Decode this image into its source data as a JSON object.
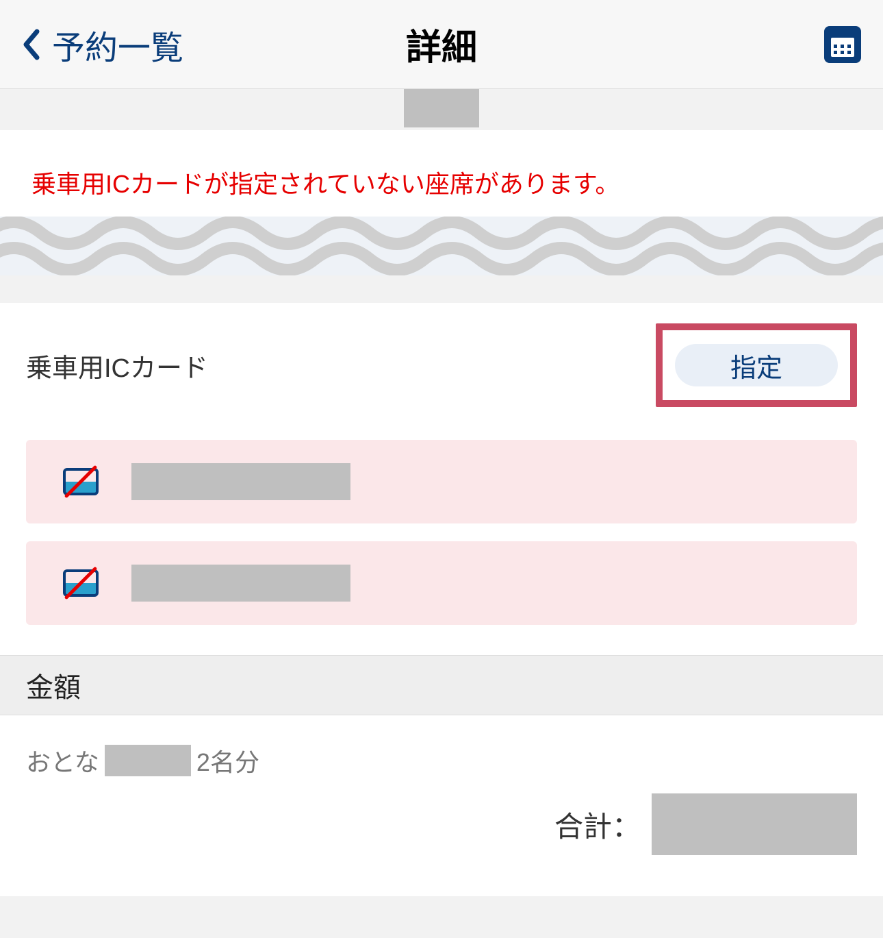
{
  "header": {
    "back_label": "予約一覧",
    "title": "詳細"
  },
  "warning": {
    "text": "乗車用ICカードが指定されていない座席があります。"
  },
  "ic_section": {
    "label": "乗車用ICカード",
    "assign_button": "指定"
  },
  "amount": {
    "section_title": "金額",
    "adult_label": "おとな",
    "count_label": "2名分",
    "total_label": "合計："
  }
}
